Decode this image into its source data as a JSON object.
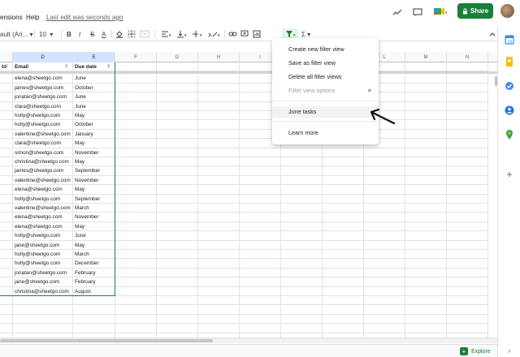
{
  "menubar": {
    "items": [
      "ensions",
      "Help"
    ],
    "last_edit": "Last edit was seconds ago",
    "share_label": "Share"
  },
  "toolbar": {
    "font_name": "ault (Ari...",
    "font_size": "10",
    "bold": "B",
    "italic": "I",
    "strike": "S",
    "text_color": "A",
    "function": "Σ"
  },
  "columns": [
    {
      "letter": "",
      "width": 16
    },
    {
      "letter": "D",
      "width": 74
    },
    {
      "letter": "E",
      "width": 52
    },
    {
      "letter": "F",
      "width": 51
    },
    {
      "letter": "G",
      "width": 51
    },
    {
      "letter": "H",
      "width": 51
    },
    {
      "letter": "I",
      "width": 51
    },
    {
      "letter": "J",
      "width": 51
    },
    {
      "letter": "K",
      "width": 51
    },
    {
      "letter": "L",
      "width": 51
    },
    {
      "letter": "M",
      "width": 51
    },
    {
      "letter": "N",
      "width": 51
    }
  ],
  "table": {
    "headers": [
      "to",
      "Email",
      "Due date"
    ],
    "rows": [
      [
        "elena@sheetgo.com",
        "June"
      ],
      [
        "james@sheetgo.com",
        "October"
      ],
      [
        "jonatan@sheetgo.com",
        "June"
      ],
      [
        "clara@sheetgo.com",
        "June"
      ],
      [
        "holly@sheetgo.com",
        "May"
      ],
      [
        "holly@sheetgo.com",
        "October"
      ],
      [
        "valentine@sheetgo.com",
        "January"
      ],
      [
        "clara@sheetgo.com",
        "May"
      ],
      [
        "simon@sheetgo.com",
        "November"
      ],
      [
        "christina@sheetgo.com",
        "May"
      ],
      [
        "james@sheetgo.com",
        "September"
      ],
      [
        "valentine@sheetgo.com",
        "November"
      ],
      [
        "elena@sheetgo.com",
        "May"
      ],
      [
        "holly@sheetgo.com",
        "September"
      ],
      [
        "valentine@sheetgo.com",
        "March"
      ],
      [
        "elena@sheetgo.com",
        "November"
      ],
      [
        "elena@sheetgo.com",
        "May"
      ],
      [
        "holly@sheetgo.com",
        "June"
      ],
      [
        "jane@sheetgo.com",
        "May"
      ],
      [
        "holly@sheetgo.com",
        "March"
      ],
      [
        "holly@sheetgo.com",
        "December"
      ],
      [
        "jonatan@sheetgo.com",
        "February"
      ],
      [
        "jane@sheetgo.com",
        "February"
      ],
      [
        "christina@sheetgo.com",
        "August"
      ]
    ]
  },
  "filter_menu": {
    "items": [
      {
        "label": "Create new filter view",
        "disabled": false
      },
      {
        "label": "Save as filter view",
        "disabled": false
      },
      {
        "label": "Delete all filter views",
        "disabled": false
      },
      {
        "label": "Filter view options",
        "disabled": true
      },
      {
        "label": "June tasks",
        "disabled": false
      },
      {
        "label": "Learn more",
        "disabled": false
      }
    ]
  },
  "bottom": {
    "explore_label": "Explore"
  },
  "colors": {
    "brand_green": "#188038",
    "filter_active_bg": "#e6f4ea",
    "selected_col_bg": "#d3e3fd"
  }
}
